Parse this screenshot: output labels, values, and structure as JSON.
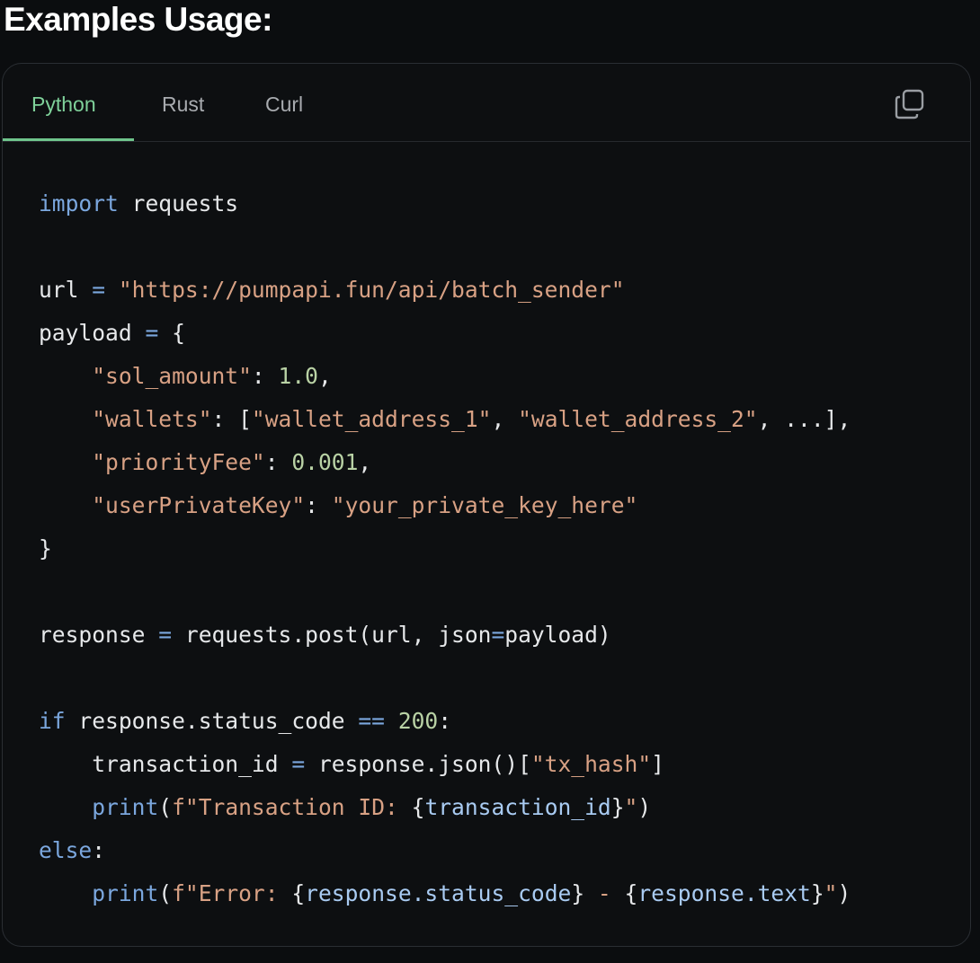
{
  "heading": "Examples Usage:",
  "tabs": [
    {
      "label": "Python",
      "active": true
    },
    {
      "label": "Rust",
      "active": false
    },
    {
      "label": "Curl",
      "active": false
    }
  ],
  "copy_icon": "copy-icon",
  "colors": {
    "background": "#0b0d0f",
    "panel": "#0d0f11",
    "active_tab": "#7fd19a",
    "keyword": "#7ba7de",
    "string": "#d8a184",
    "number": "#b9d2a5",
    "text": "#e6e8ea"
  },
  "code": {
    "lines": [
      "import requests",
      "",
      "url = \"https://pumpapi.fun/api/batch_sender\"",
      "payload = {",
      "    \"sol_amount\": 1.0,",
      "    \"wallets\": [\"wallet_address_1\", \"wallet_address_2\", ...],",
      "    \"priorityFee\": 0.001,",
      "    \"userPrivateKey\": \"your_private_key_here\"",
      "}",
      "",
      "response = requests.post(url, json=payload)",
      "",
      "if response.status_code == 200:",
      "    transaction_id = response.json()[\"tx_hash\"]",
      "    print(f\"Transaction ID: {transaction_id}\")",
      "else:",
      "    print(f\"Error: {response.status_code} - {response.text}\")"
    ]
  }
}
